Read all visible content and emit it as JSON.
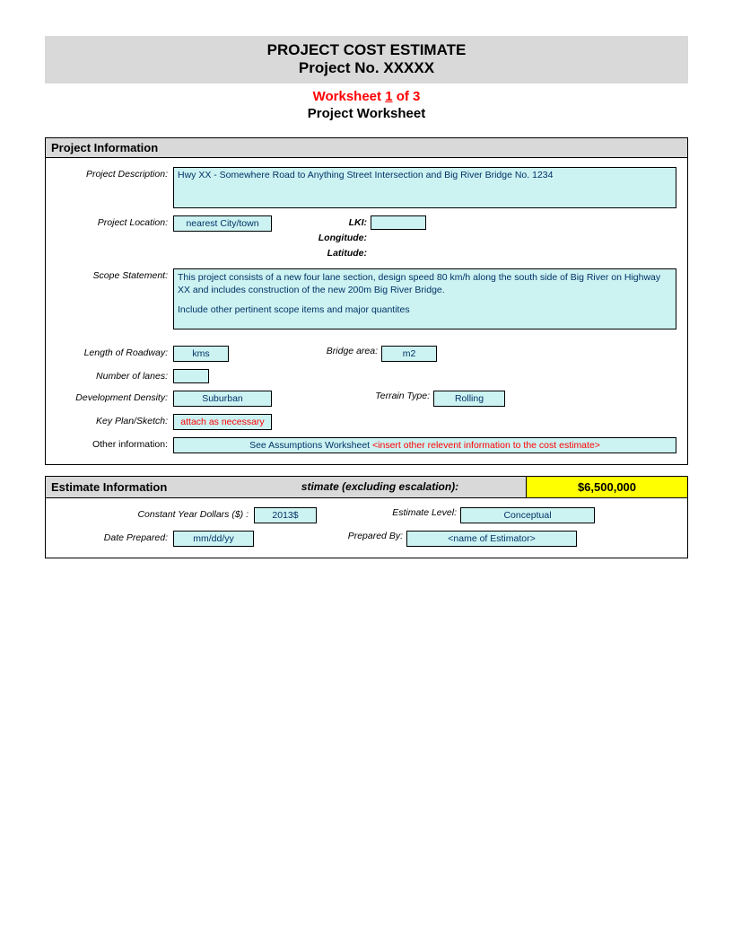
{
  "header": {
    "line1": "PROJECT COST ESTIMATE",
    "line2": "Project No. XXXXX",
    "worksheet_prefix": "Worksheet ",
    "worksheet_num": "1",
    "worksheet_suffix": " of 3",
    "worksheet_title": "Project Worksheet"
  },
  "project_info": {
    "section_title": "Project Information",
    "labels": {
      "description": "Project Description:",
      "location": "Project Location:",
      "lki": "LKI:",
      "longitude": "Longitude:",
      "latitude": "Latitude:",
      "scope": "Scope Statement:",
      "length": "Length of Roadway:",
      "bridge_area": "Bridge area:",
      "lanes": "Number of lanes:",
      "density": "Development Density:",
      "terrain": "Terrain Type:",
      "keyplan": "Key Plan/Sketch:",
      "other": "Other information:"
    },
    "values": {
      "description": "Hwy XX - Somewhere Road to Anything Street Intersection and Big River Bridge No. 1234",
      "location": "nearest City/town",
      "lki": "",
      "longitude": "",
      "latitude": "",
      "scope_line1": "This project consists of a new four lane section, design speed 80 km/h along the south side of Big River on Highway XX and includes construction of the new 200m Big River Bridge.",
      "scope_line2": "Include other pertinent scope items and major quantites",
      "length_unit": "kms",
      "bridge_unit": "m2",
      "lanes": "",
      "density": "Suburban",
      "terrain": "Rolling",
      "keyplan": "attach as necessary",
      "other_prefix": "See Assumptions Worksheet ",
      "other_placeholder": "<insert other relevent information to the cost estimate>"
    }
  },
  "estimate_info": {
    "section_title": "Estimate Information",
    "subtitle": "stimate (excluding escalation):",
    "amount": "$6,500,000",
    "labels": {
      "constant_year": "Constant Year Dollars ($) :",
      "estimate_level": "Estimate Level:",
      "date_prepared": "Date Prepared:",
      "prepared_by": "Prepared By:"
    },
    "values": {
      "constant_year": "2013$",
      "estimate_level": "Conceptual",
      "date_prepared": "mm/dd/yy",
      "prepared_by": "<name of Estimator>"
    }
  }
}
